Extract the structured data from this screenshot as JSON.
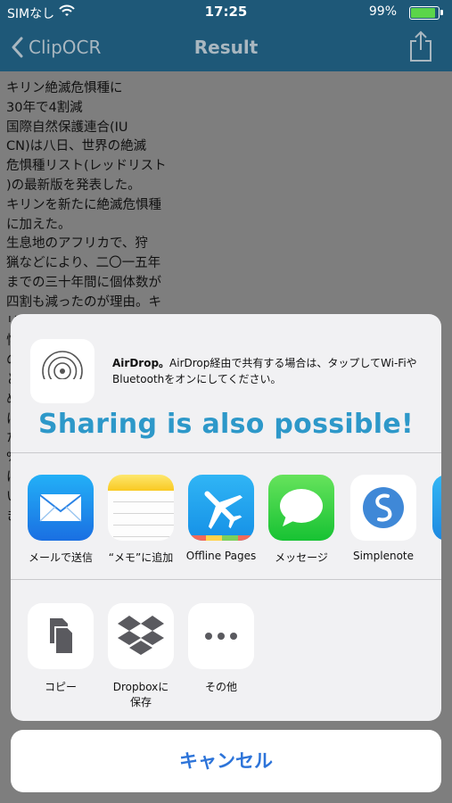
{
  "status_bar": {
    "carrier": "SIMなし",
    "time": "17:25",
    "battery": "99%"
  },
  "nav_bar": {
    "back_label": "ClipOCR",
    "title": "Result"
  },
  "ocr_text": "キリン絶滅危惧種に\n30年で4割減\n国際自然保護連合(IU\nCN)は八日、世界の絶滅\n危惧種リスト(レッドリスト\n)の最新版を発表した。\nキリンを新たに絶滅危惧種\nに加えた。\n生息地のアフリカで、狩\n猟などにより、二〇一五年\nまでの三十年間に個体数が\n四割も減ったのが理由。キ\nリンは三ランクある絶滅危\n惧\nの\nと\nめ\nに\nた\n%\nに\nい\nき",
  "share_sheet": {
    "airdrop_title": "AirDrop。",
    "airdrop_text": "AirDrop経由で共有する場合は、タップしてWi-FiやBluetoothをオンにしてください。",
    "banner": "Sharing is also possible!",
    "apps": [
      {
        "label": "メールで送信",
        "icon": "mail-icon"
      },
      {
        "label": "“メモ”に追加",
        "icon": "notes-icon"
      },
      {
        "label": "Offline Pages",
        "icon": "offline-pages-icon"
      },
      {
        "label": "メッセージ",
        "icon": "messages-icon"
      },
      {
        "label": "Simplenote",
        "icon": "simplenote-icon"
      }
    ],
    "actions": [
      {
        "label": "コピー",
        "icon": "copy-icon"
      },
      {
        "label": "Dropboxに保存",
        "icon": "dropbox-icon"
      },
      {
        "label": "その他",
        "icon": "more-icon"
      }
    ],
    "cancel": "キャンセル"
  }
}
